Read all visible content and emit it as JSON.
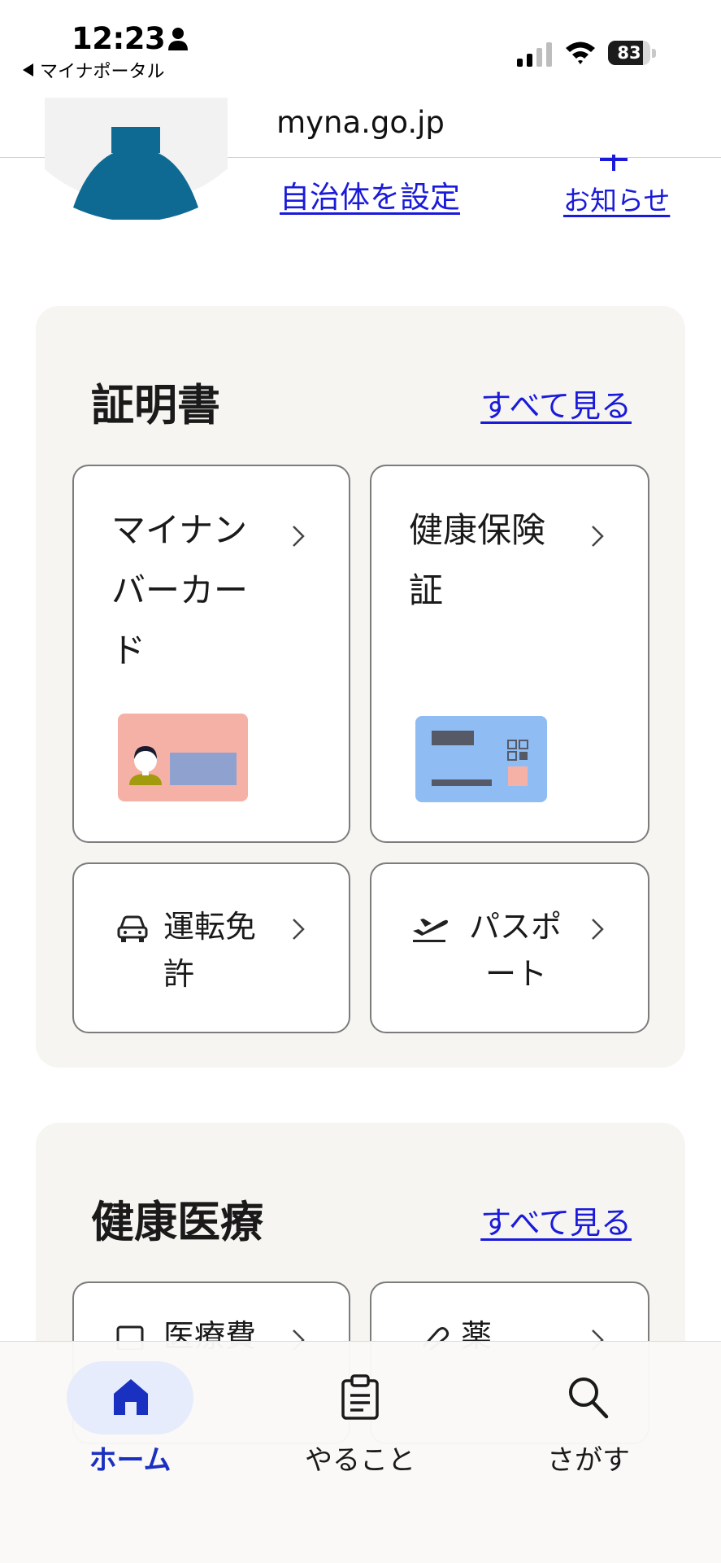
{
  "status_bar": {
    "time": "12:23",
    "back_label": "マイナポータル",
    "battery_level": "83",
    "battery_fraction": 0.83
  },
  "browser": {
    "url": "myna.go.jp"
  },
  "top_links": {
    "municipality": "自治体を設定",
    "notices": "お知らせ"
  },
  "certificates": {
    "title": "証明書",
    "see_all": "すべて見る",
    "tiles": [
      {
        "label_lines": [
          "マイナン",
          "バーカー",
          "ド"
        ],
        "icon": "mynumber-card-illustration"
      },
      {
        "label_lines": [
          "健康保険",
          "証"
        ],
        "icon": "health-insurance-card-illustration"
      },
      {
        "label_lines": [
          "運転免",
          "許"
        ],
        "icon": "car-icon"
      },
      {
        "label_lines": [
          "パスポ",
          "ート"
        ],
        "icon": "airplane-takeoff-icon"
      }
    ]
  },
  "health": {
    "title": "健康医療",
    "see_all": "すべて見る",
    "tiles": [
      {
        "label": "医療費",
        "icon": "document-icon"
      },
      {
        "label": "薬",
        "icon": "pill-icon"
      }
    ]
  },
  "bottom_nav": {
    "items": [
      {
        "label": "ホーム",
        "icon": "home-icon",
        "active": true
      },
      {
        "label": "やること",
        "icon": "clipboard-icon",
        "active": false
      },
      {
        "label": "さがす",
        "icon": "search-icon",
        "active": false
      }
    ]
  },
  "colors": {
    "link": "#1a1adb",
    "accent": "#1a30c0",
    "section_bg": "#f6f5f2",
    "avatar": "#0f6a93"
  }
}
